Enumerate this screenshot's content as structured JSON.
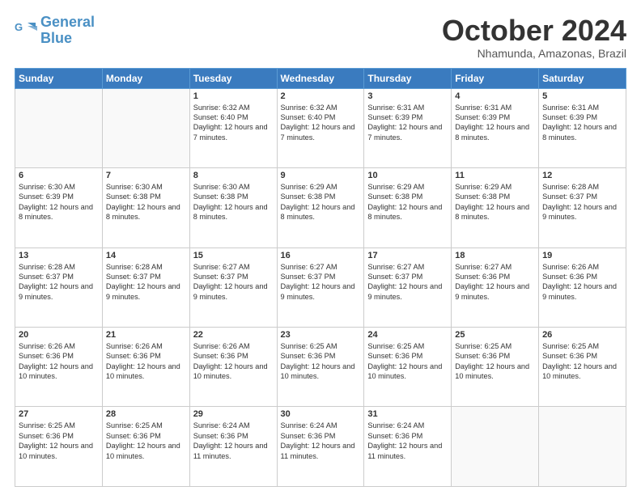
{
  "header": {
    "logo_line1": "General",
    "logo_line2": "Blue",
    "month": "October 2024",
    "location": "Nhamunda, Amazonas, Brazil"
  },
  "days_of_week": [
    "Sunday",
    "Monday",
    "Tuesday",
    "Wednesday",
    "Thursday",
    "Friday",
    "Saturday"
  ],
  "weeks": [
    [
      {
        "day": "",
        "info": ""
      },
      {
        "day": "",
        "info": ""
      },
      {
        "day": "1",
        "info": "Sunrise: 6:32 AM\nSunset: 6:40 PM\nDaylight: 12 hours and 7 minutes."
      },
      {
        "day": "2",
        "info": "Sunrise: 6:32 AM\nSunset: 6:40 PM\nDaylight: 12 hours and 7 minutes."
      },
      {
        "day": "3",
        "info": "Sunrise: 6:31 AM\nSunset: 6:39 PM\nDaylight: 12 hours and 7 minutes."
      },
      {
        "day": "4",
        "info": "Sunrise: 6:31 AM\nSunset: 6:39 PM\nDaylight: 12 hours and 8 minutes."
      },
      {
        "day": "5",
        "info": "Sunrise: 6:31 AM\nSunset: 6:39 PM\nDaylight: 12 hours and 8 minutes."
      }
    ],
    [
      {
        "day": "6",
        "info": "Sunrise: 6:30 AM\nSunset: 6:39 PM\nDaylight: 12 hours and 8 minutes."
      },
      {
        "day": "7",
        "info": "Sunrise: 6:30 AM\nSunset: 6:38 PM\nDaylight: 12 hours and 8 minutes."
      },
      {
        "day": "8",
        "info": "Sunrise: 6:30 AM\nSunset: 6:38 PM\nDaylight: 12 hours and 8 minutes."
      },
      {
        "day": "9",
        "info": "Sunrise: 6:29 AM\nSunset: 6:38 PM\nDaylight: 12 hours and 8 minutes."
      },
      {
        "day": "10",
        "info": "Sunrise: 6:29 AM\nSunset: 6:38 PM\nDaylight: 12 hours and 8 minutes."
      },
      {
        "day": "11",
        "info": "Sunrise: 6:29 AM\nSunset: 6:38 PM\nDaylight: 12 hours and 8 minutes."
      },
      {
        "day": "12",
        "info": "Sunrise: 6:28 AM\nSunset: 6:37 PM\nDaylight: 12 hours and 9 minutes."
      }
    ],
    [
      {
        "day": "13",
        "info": "Sunrise: 6:28 AM\nSunset: 6:37 PM\nDaylight: 12 hours and 9 minutes."
      },
      {
        "day": "14",
        "info": "Sunrise: 6:28 AM\nSunset: 6:37 PM\nDaylight: 12 hours and 9 minutes."
      },
      {
        "day": "15",
        "info": "Sunrise: 6:27 AM\nSunset: 6:37 PM\nDaylight: 12 hours and 9 minutes."
      },
      {
        "day": "16",
        "info": "Sunrise: 6:27 AM\nSunset: 6:37 PM\nDaylight: 12 hours and 9 minutes."
      },
      {
        "day": "17",
        "info": "Sunrise: 6:27 AM\nSunset: 6:37 PM\nDaylight: 12 hours and 9 minutes."
      },
      {
        "day": "18",
        "info": "Sunrise: 6:27 AM\nSunset: 6:36 PM\nDaylight: 12 hours and 9 minutes."
      },
      {
        "day": "19",
        "info": "Sunrise: 6:26 AM\nSunset: 6:36 PM\nDaylight: 12 hours and 9 minutes."
      }
    ],
    [
      {
        "day": "20",
        "info": "Sunrise: 6:26 AM\nSunset: 6:36 PM\nDaylight: 12 hours and 10 minutes."
      },
      {
        "day": "21",
        "info": "Sunrise: 6:26 AM\nSunset: 6:36 PM\nDaylight: 12 hours and 10 minutes."
      },
      {
        "day": "22",
        "info": "Sunrise: 6:26 AM\nSunset: 6:36 PM\nDaylight: 12 hours and 10 minutes."
      },
      {
        "day": "23",
        "info": "Sunrise: 6:25 AM\nSunset: 6:36 PM\nDaylight: 12 hours and 10 minutes."
      },
      {
        "day": "24",
        "info": "Sunrise: 6:25 AM\nSunset: 6:36 PM\nDaylight: 12 hours and 10 minutes."
      },
      {
        "day": "25",
        "info": "Sunrise: 6:25 AM\nSunset: 6:36 PM\nDaylight: 12 hours and 10 minutes."
      },
      {
        "day": "26",
        "info": "Sunrise: 6:25 AM\nSunset: 6:36 PM\nDaylight: 12 hours and 10 minutes."
      }
    ],
    [
      {
        "day": "27",
        "info": "Sunrise: 6:25 AM\nSunset: 6:36 PM\nDaylight: 12 hours and 10 minutes."
      },
      {
        "day": "28",
        "info": "Sunrise: 6:25 AM\nSunset: 6:36 PM\nDaylight: 12 hours and 10 minutes."
      },
      {
        "day": "29",
        "info": "Sunrise: 6:24 AM\nSunset: 6:36 PM\nDaylight: 12 hours and 11 minutes."
      },
      {
        "day": "30",
        "info": "Sunrise: 6:24 AM\nSunset: 6:36 PM\nDaylight: 12 hours and 11 minutes."
      },
      {
        "day": "31",
        "info": "Sunrise: 6:24 AM\nSunset: 6:36 PM\nDaylight: 12 hours and 11 minutes."
      },
      {
        "day": "",
        "info": ""
      },
      {
        "day": "",
        "info": ""
      }
    ]
  ]
}
